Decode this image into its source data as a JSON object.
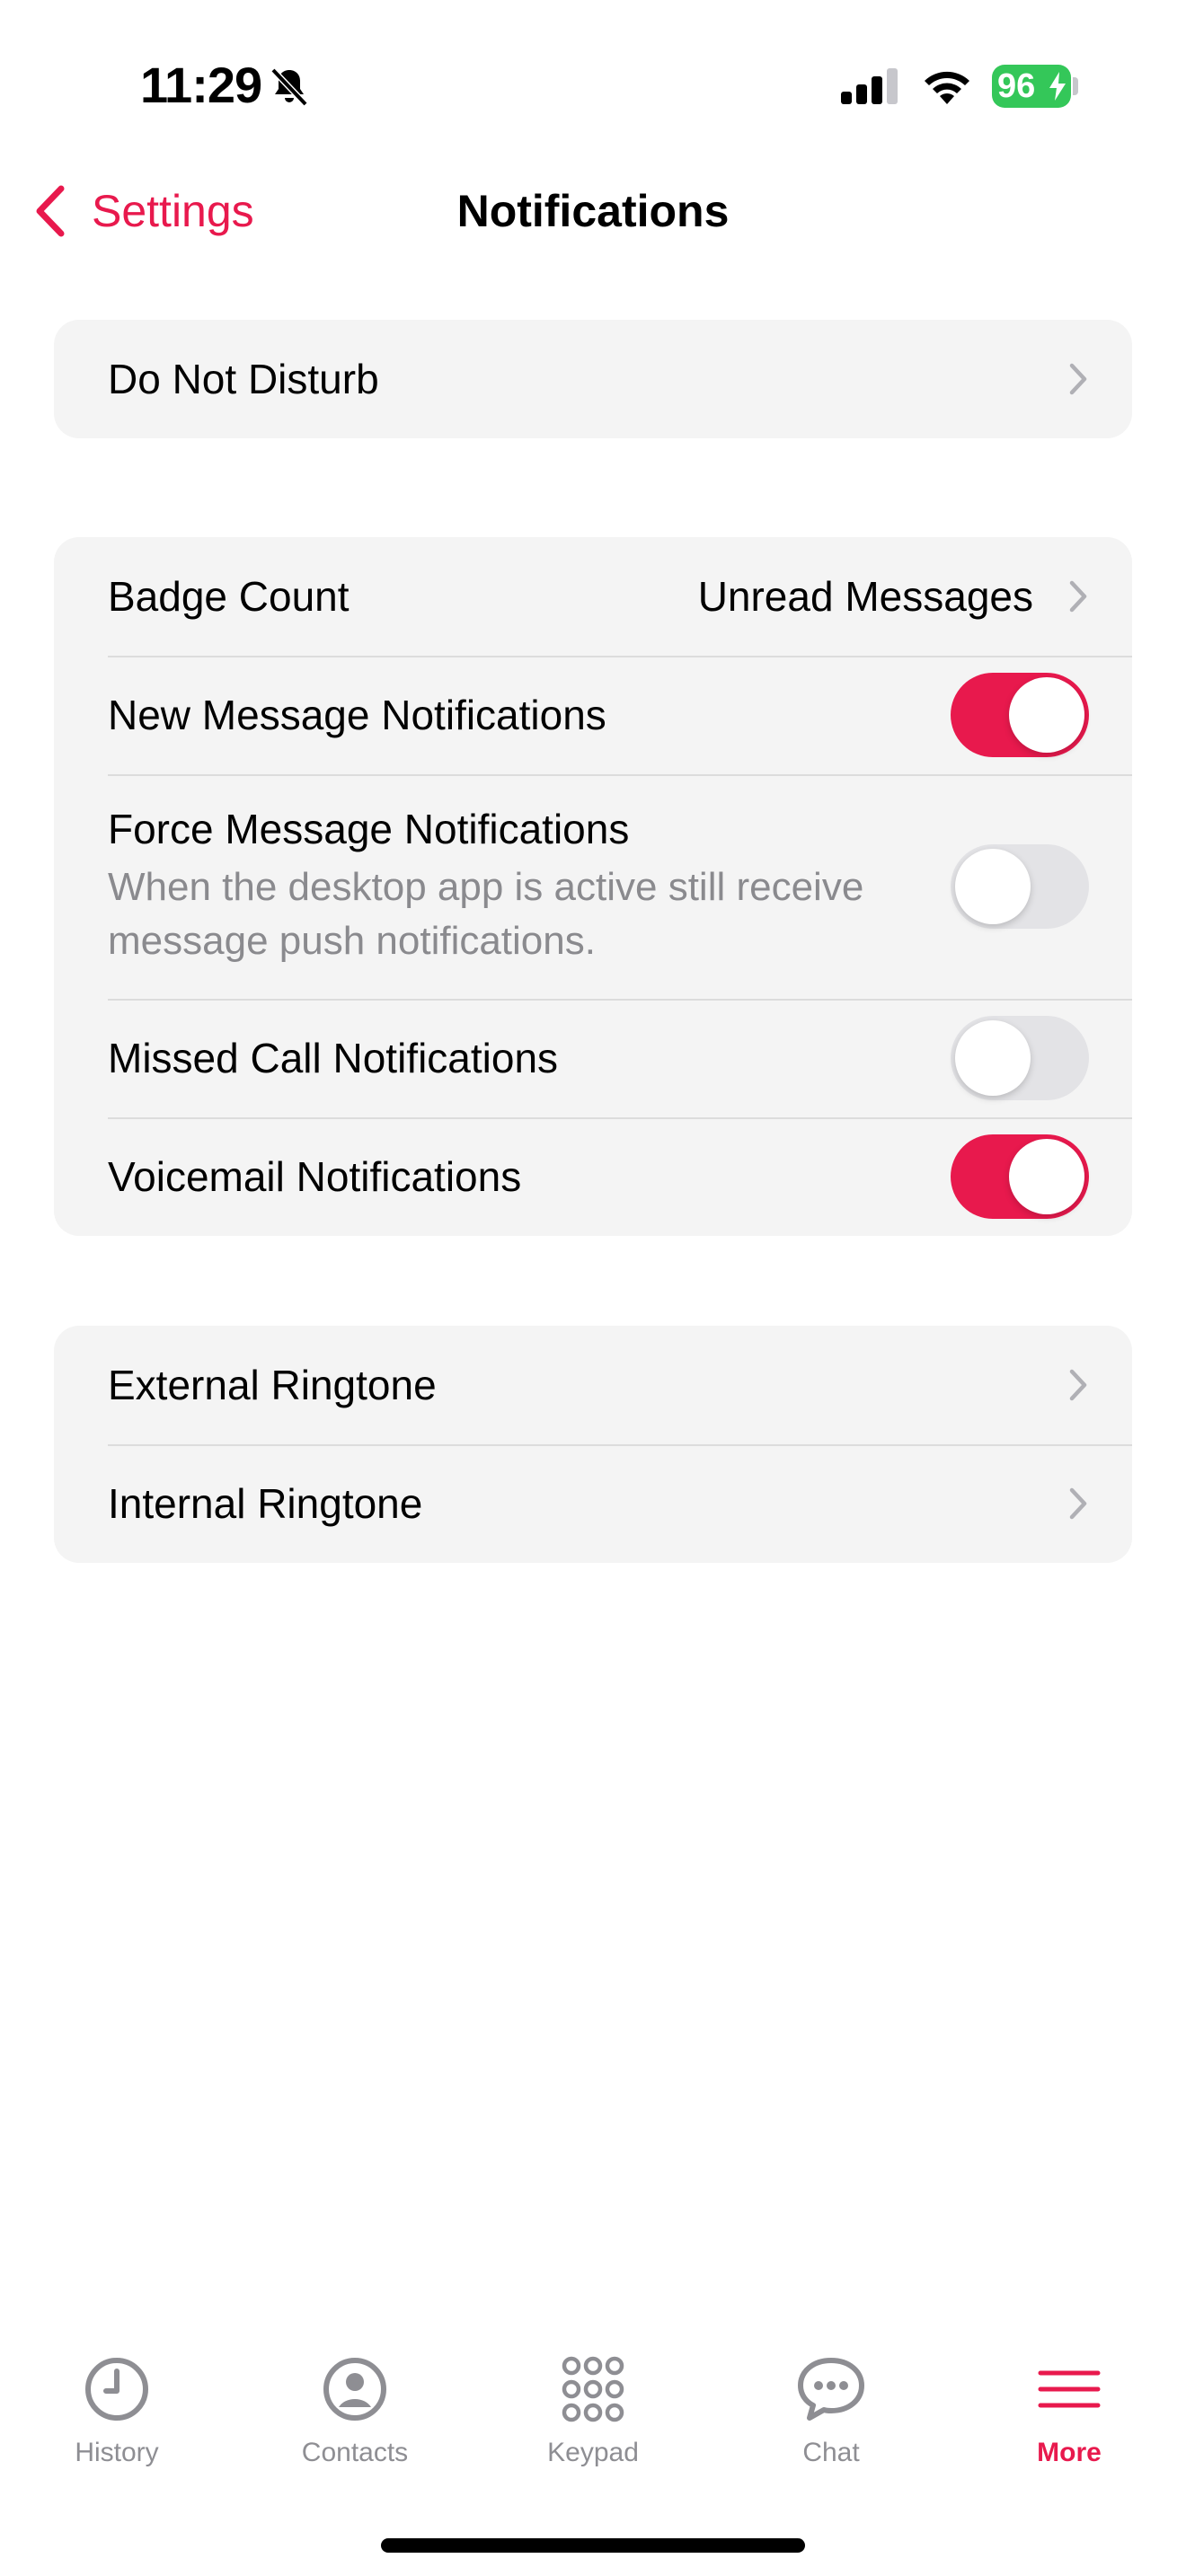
{
  "status_bar": {
    "time": "11:29",
    "battery": "96",
    "icons": [
      "bell-slash-icon",
      "cellular-signal-icon",
      "wifi-icon",
      "battery-charging-icon"
    ]
  },
  "nav": {
    "back_label": "Settings",
    "title": "Notifications"
  },
  "groups": {
    "dnd": {
      "label": "Do Not Disturb"
    },
    "notifications": {
      "badge_count": {
        "label": "Badge Count",
        "value": "Unread Messages"
      },
      "new_message": {
        "label": "New Message Notifications",
        "enabled": true
      },
      "force_message": {
        "label": "Force Message Notifications",
        "description": "When the desktop app is active still receive message push notifications.",
        "enabled": false
      },
      "missed_call": {
        "label": "Missed Call Notifications",
        "enabled": false
      },
      "voicemail": {
        "label": "Voicemail Notifications",
        "enabled": true
      }
    },
    "ringtones": {
      "external": {
        "label": "External Ringtone"
      },
      "internal": {
        "label": "Internal Ringtone"
      }
    }
  },
  "tab_bar": {
    "tabs": [
      {
        "label": "History",
        "icon": "clock-icon"
      },
      {
        "label": "Contacts",
        "icon": "person-icon"
      },
      {
        "label": "Keypad",
        "icon": "keypad-icon"
      },
      {
        "label": "Chat",
        "icon": "chat-bubble-icon"
      },
      {
        "label": "More",
        "icon": "menu-icon",
        "active": true
      }
    ]
  },
  "colors": {
    "accent": "#e8194d",
    "group_background": "#f4f4f4",
    "secondary_text": "#8a8a8e",
    "battery": "#34c759"
  }
}
